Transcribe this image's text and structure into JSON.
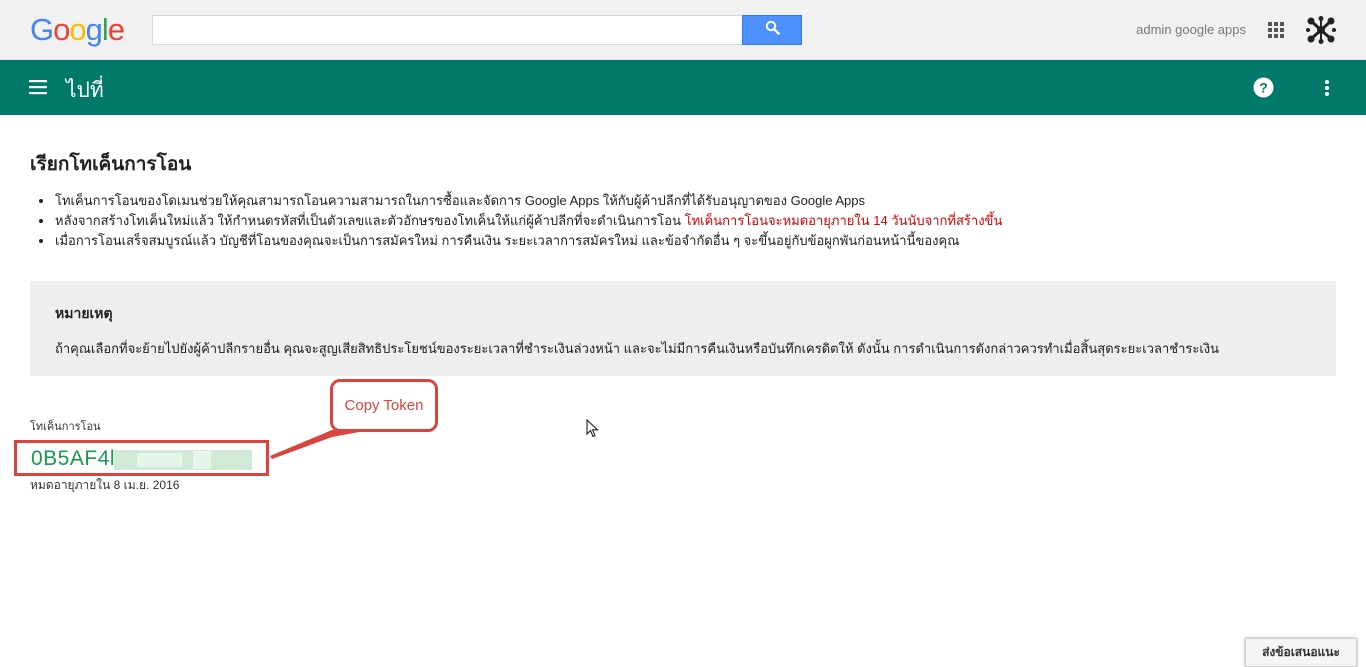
{
  "header": {
    "logo_letters": [
      {
        "char": "G",
        "color": "#4285f4"
      },
      {
        "char": "o",
        "color": "#ea4335"
      },
      {
        "char": "o",
        "color": "#fbbc05"
      },
      {
        "char": "g",
        "color": "#4285f4"
      },
      {
        "char": "l",
        "color": "#34a853"
      },
      {
        "char": "e",
        "color": "#ea4335"
      }
    ],
    "search_value": "",
    "search_icon": "search-icon",
    "account_name": "admin google apps",
    "apps_icon": "apps-grid-icon",
    "avatar_icon": "profile-avatar"
  },
  "appbar": {
    "menu_icon": "hamburger-menu-icon",
    "title": "ไปที่",
    "help_icon": "help-icon",
    "more_icon": "more-vert-icon",
    "background_color": "#00796b"
  },
  "main": {
    "title": "เรียกโทเค็นการโอน",
    "bullets": [
      {
        "text": "โทเค็นการโอนของโดเมนช่วยให้คุณสามารถโอนความสามารถในการซื้อและจัดการ Google Apps ให้กับผู้ค้าปลีกที่ได้รับอนุญาตของ Google Apps",
        "warning": ""
      },
      {
        "text": "หลังจากสร้างโทเค็นใหม่แล้ว ให้กำหนดรหัสที่เป็นตัวเลขและตัวอักษรของโทเค็นให้แก่ผู้ค้าปลีกที่จะดำเนินการโอน ",
        "warning": "โทเค็นการโอนจะหมดอายุภายใน 14 วันนับจากที่สร้างขึ้น"
      },
      {
        "text": "เมื่อการโอนเสร็จสมบูรณ์แล้ว บัญชีที่โอนของคุณจะเป็นการสมัครใหม่ การคืนเงิน ระยะเวลาการสมัครใหม่ และข้อจำกัดอื่น ๆ จะขึ้นอยู่กับข้อผูกพันก่อนหน้านี้ของคุณ",
        "warning": ""
      }
    ],
    "note": {
      "title": "หมายเหตุ",
      "body": "ถ้าคุณเลือกที่จะย้ายไปยังผู้ค้าปลีกรายอื่น คุณจะสูญเสียสิทธิประโยชน์ของระยะเวลาที่ชำระเงินล่วงหน้า และจะไม่มีการคืนเงินหรือบันทึกเครดิตให้ ดังนั้น การดำเนินการดังกล่าวควรทำเมื่อสิ้นสุดระยะเวลาชำระเงิน"
    },
    "token": {
      "label": "โทเค็นการโอน",
      "value": "0B5AF4l",
      "expiry": "หมดอายุภายใน 8 เม.ย. 2016",
      "value_color": "#1a9a4e"
    },
    "callout": {
      "text": "Copy Token",
      "color": "#d9443c"
    }
  },
  "footer": {
    "feedback_label": "ส่งข้อเสนอแนะ"
  }
}
